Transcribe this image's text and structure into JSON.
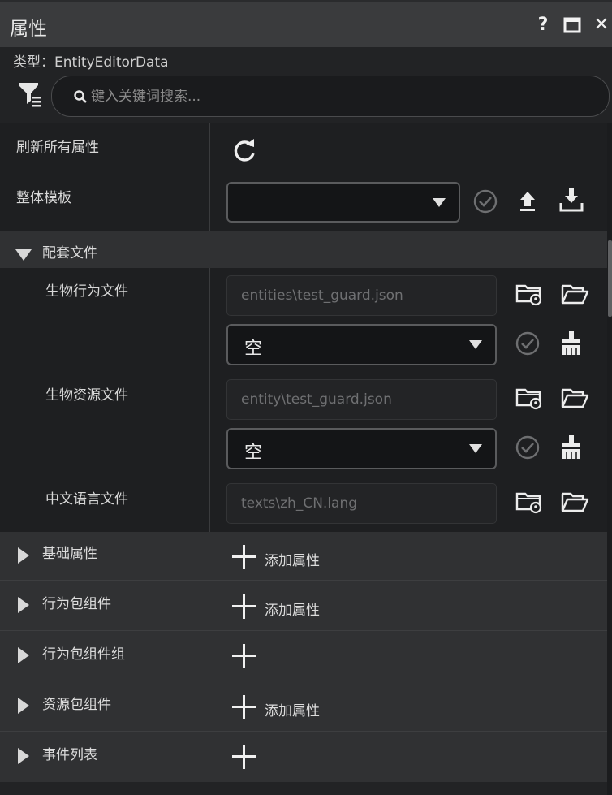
{
  "window": {
    "title": "属性",
    "help_glyph": "?",
    "close_glyph": "✕"
  },
  "type_line": "类型：EntityEditorData",
  "search": {
    "placeholder": "键入关键词搜索..."
  },
  "top_props": {
    "refresh_label": "刷新所有属性",
    "template_label": "整体模板",
    "template_value": ""
  },
  "files_section": {
    "title": "配套文件",
    "rows": [
      {
        "label": "生物行为文件",
        "path": "entities\\test_guard.json",
        "select": "空"
      },
      {
        "label": "生物资源文件",
        "path": "entity\\test_guard.json",
        "select": "空"
      },
      {
        "label": "中文语言文件",
        "path": "texts\\zh_CN.lang"
      }
    ]
  },
  "collapsed_sections": [
    {
      "name": "基础属性",
      "add_label": "添加属性"
    },
    {
      "name": "行为包组件",
      "add_label": "添加属性"
    },
    {
      "name": "行为包组件组",
      "add_label": ""
    },
    {
      "name": "资源包组件",
      "add_label": "添加属性"
    },
    {
      "name": "事件列表",
      "add_label": ""
    }
  ],
  "colors": {
    "background": "#222325",
    "titlebar": "#3a3b3d",
    "section": "#303133",
    "text": "#d8d8d8"
  }
}
